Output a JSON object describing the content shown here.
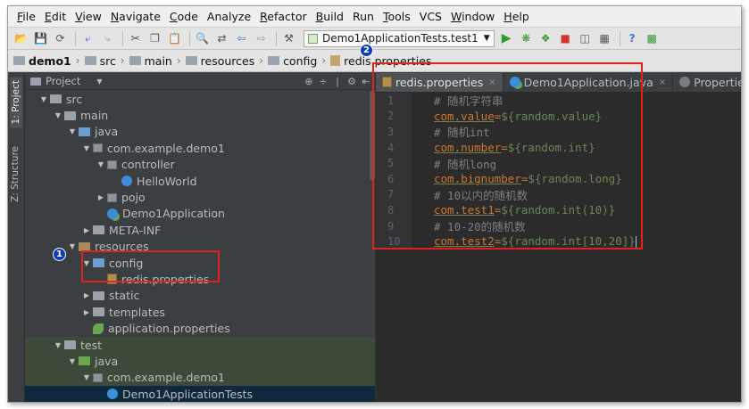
{
  "menubar": {
    "items": [
      {
        "first": "F",
        "rest": "ile"
      },
      {
        "first": "E",
        "rest": "dit"
      },
      {
        "first": "V",
        "rest": "iew"
      },
      {
        "first": "N",
        "rest": "avigate"
      },
      {
        "first": "C",
        "rest": "ode"
      },
      {
        "first": "",
        "rest": "Analyze"
      },
      {
        "first": "R",
        "rest": "efactor"
      },
      {
        "first": "B",
        "rest": "uild"
      },
      {
        "first": "",
        "rest": "Run"
      },
      {
        "first": "T",
        "rest": "ools"
      },
      {
        "first": "",
        "rest": "VCS"
      },
      {
        "first": "W",
        "rest": "indow"
      },
      {
        "first": "H",
        "rest": "elp"
      }
    ]
  },
  "toolbar": {
    "run_config": "Demo1ApplicationTests.test1"
  },
  "breadcrumb": {
    "items": [
      "demo1",
      "src",
      "main",
      "resources",
      "config",
      "redis.properties"
    ]
  },
  "left_strip": {
    "project_tab": "1: Project",
    "structure_tab": "Z: Structure"
  },
  "project_panel": {
    "title": "Project"
  },
  "tree": [
    {
      "label": "src",
      "indent": 1,
      "arrow": "open",
      "icon": "folder"
    },
    {
      "label": "main",
      "indent": 2,
      "arrow": "open",
      "icon": "folder"
    },
    {
      "label": "java",
      "indent": 3,
      "arrow": "open",
      "icon": "folder-blue"
    },
    {
      "label": "com.example.demo1",
      "indent": 4,
      "arrow": "open",
      "icon": "package"
    },
    {
      "label": "controller",
      "indent": 5,
      "arrow": "open",
      "icon": "package"
    },
    {
      "label": "HelloWorld",
      "indent": 6,
      "arrow": "none",
      "icon": "class"
    },
    {
      "label": "pojo",
      "indent": 5,
      "arrow": "closed",
      "icon": "package"
    },
    {
      "label": "Demo1Application",
      "indent": 5,
      "arrow": "none",
      "icon": "spring-class"
    },
    {
      "label": "META-INF",
      "indent": 4,
      "arrow": "closed",
      "icon": "folder"
    },
    {
      "label": "resources",
      "indent": 3,
      "arrow": "open",
      "icon": "folder-res"
    },
    {
      "label": "config",
      "indent": 4,
      "arrow": "open",
      "icon": "folder-blue"
    },
    {
      "label": "redis.properties",
      "indent": 5,
      "arrow": "none",
      "icon": "properties"
    },
    {
      "label": "static",
      "indent": 4,
      "arrow": "closed",
      "icon": "folder"
    },
    {
      "label": "templates",
      "indent": 4,
      "arrow": "closed",
      "icon": "folder"
    },
    {
      "label": "application.properties",
      "indent": 4,
      "arrow": "none",
      "icon": "app-properties"
    },
    {
      "label": "test",
      "indent": 2,
      "arrow": "open",
      "icon": "folder"
    },
    {
      "label": "java",
      "indent": 3,
      "arrow": "open",
      "icon": "folder-green"
    },
    {
      "label": "com.example.demo1",
      "indent": 4,
      "arrow": "open",
      "icon": "package"
    },
    {
      "label": "Demo1ApplicationTests",
      "indent": 5,
      "arrow": "none",
      "icon": "class"
    }
  ],
  "editor": {
    "tabs": [
      {
        "label": "redis.properties",
        "active": true,
        "close": "×",
        "icon": "properties"
      },
      {
        "label": "Demo1Application.java",
        "active": false,
        "close": "×",
        "icon": "spring-class"
      },
      {
        "label": "Properties.java",
        "active": false,
        "close": "×",
        "icon": "class-gray"
      }
    ],
    "lines": [
      {
        "num": "1",
        "comment": "# 随机字符串"
      },
      {
        "num": "2",
        "key": "com.value",
        "eq": "=",
        "value": "${random.value}"
      },
      {
        "num": "3",
        "comment": "# 随机int"
      },
      {
        "num": "4",
        "key": "com.number",
        "eq": "=",
        "value": "${random.int}"
      },
      {
        "num": "5",
        "comment": "# 随机long"
      },
      {
        "num": "6",
        "key": "com.bignumber",
        "eq": "=",
        "value": "${random.long}"
      },
      {
        "num": "7",
        "comment": "# 10以内的随机数"
      },
      {
        "num": "8",
        "key": "com.test1",
        "eq": "=",
        "value": "${random.int(10)}"
      },
      {
        "num": "9",
        "comment": "# 10-20的随机数"
      },
      {
        "num": "10",
        "key": "com.test2",
        "eq": "=",
        "value": "${random.int[10,20]}"
      }
    ]
  },
  "annotations": {
    "badge1": "1",
    "badge2": "2"
  },
  "colors": {
    "annotation_red": "#e0241b",
    "badge_blue": "#0e3eb7",
    "editor_bg": "#2b2b2b",
    "panel_bg": "#3c3f41"
  }
}
